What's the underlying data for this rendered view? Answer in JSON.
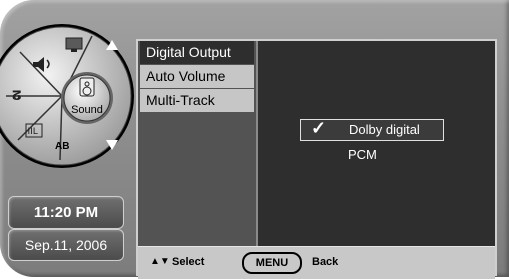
{
  "wheel": {
    "center_label": "Sound",
    "ab_label": "AB"
  },
  "clock": {
    "time": "11:20 PM",
    "date": "Sep.11, 2006"
  },
  "menu": {
    "items": [
      {
        "label": "Digital Output"
      },
      {
        "label": "Auto Volume"
      },
      {
        "label": "Multi-Track"
      }
    ]
  },
  "options": {
    "selected": {
      "check": "✓",
      "label": "Dolby digital"
    },
    "other": {
      "label": "PCM"
    }
  },
  "footer": {
    "arrows": "▲▼",
    "select_label": "Select",
    "menu_key": "MENU",
    "back_label": "Back"
  },
  "colors": {
    "panel_bg": "#2e2e2e",
    "highlight": "#c6c6c6",
    "frame": "#8e8e8e"
  }
}
